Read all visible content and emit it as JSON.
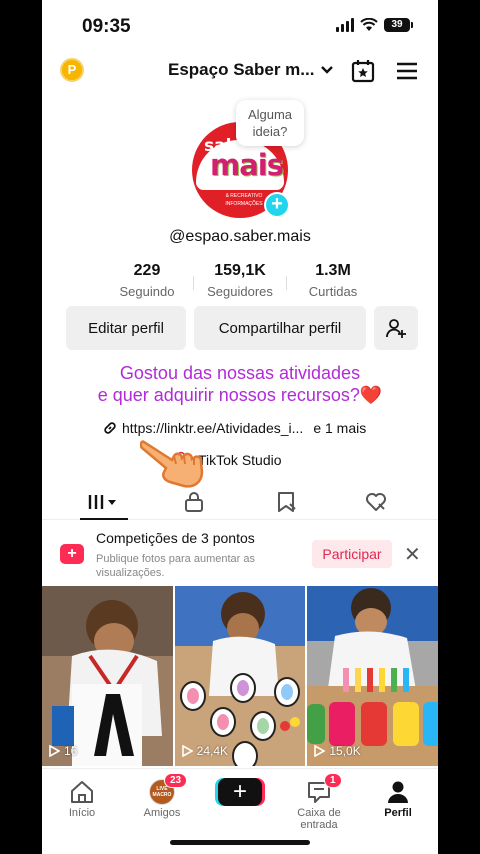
{
  "status": {
    "time": "09:35",
    "battery": "39"
  },
  "header": {
    "account_name": "Espaço Saber m...",
    "coin_letter": "P"
  },
  "profile": {
    "avatar_texts": {
      "line1": "saber",
      "line2": "mais",
      "tiny": "ESPAÇO PEDAGÓGICO & RECREATIVO\nINFORMAÇÕES"
    },
    "idea_bubble": "Alguma ideia?",
    "handle": "@espao.saber.mais",
    "stats": [
      {
        "num": "229",
        "label": "Seguindo"
      },
      {
        "num": "159,1K",
        "label": "Seguidores"
      },
      {
        "num": "1.3M",
        "label": "Curtidas"
      }
    ],
    "edit_label": "Editar perfil",
    "share_label": "Compartilhar perfil",
    "bio_line1": "Gostou das nossas atividades",
    "bio_line2": "e quer adquirir nossos recursos?❤️",
    "link_text": "https://linktr.ee/Atividades_i...",
    "link_more": "e 1 mais",
    "studio_label": "TikTok Studio"
  },
  "promo": {
    "title": "Competições de 3 pontos",
    "subtitle": "Publique fotos para aumentar as visualizações.",
    "button": "Participar",
    "close": "✕"
  },
  "videos": [
    {
      "views": "16"
    },
    {
      "views": "24,4K"
    },
    {
      "views": "15,0K"
    }
  ],
  "nav": {
    "home": "Início",
    "friends": "Amigos",
    "friends_badge": "23",
    "friends_avatar_text": "LIVE\nMACRO",
    "inbox": "Caixa de entrada",
    "inbox_badge": "1",
    "profile": "Perfil"
  }
}
